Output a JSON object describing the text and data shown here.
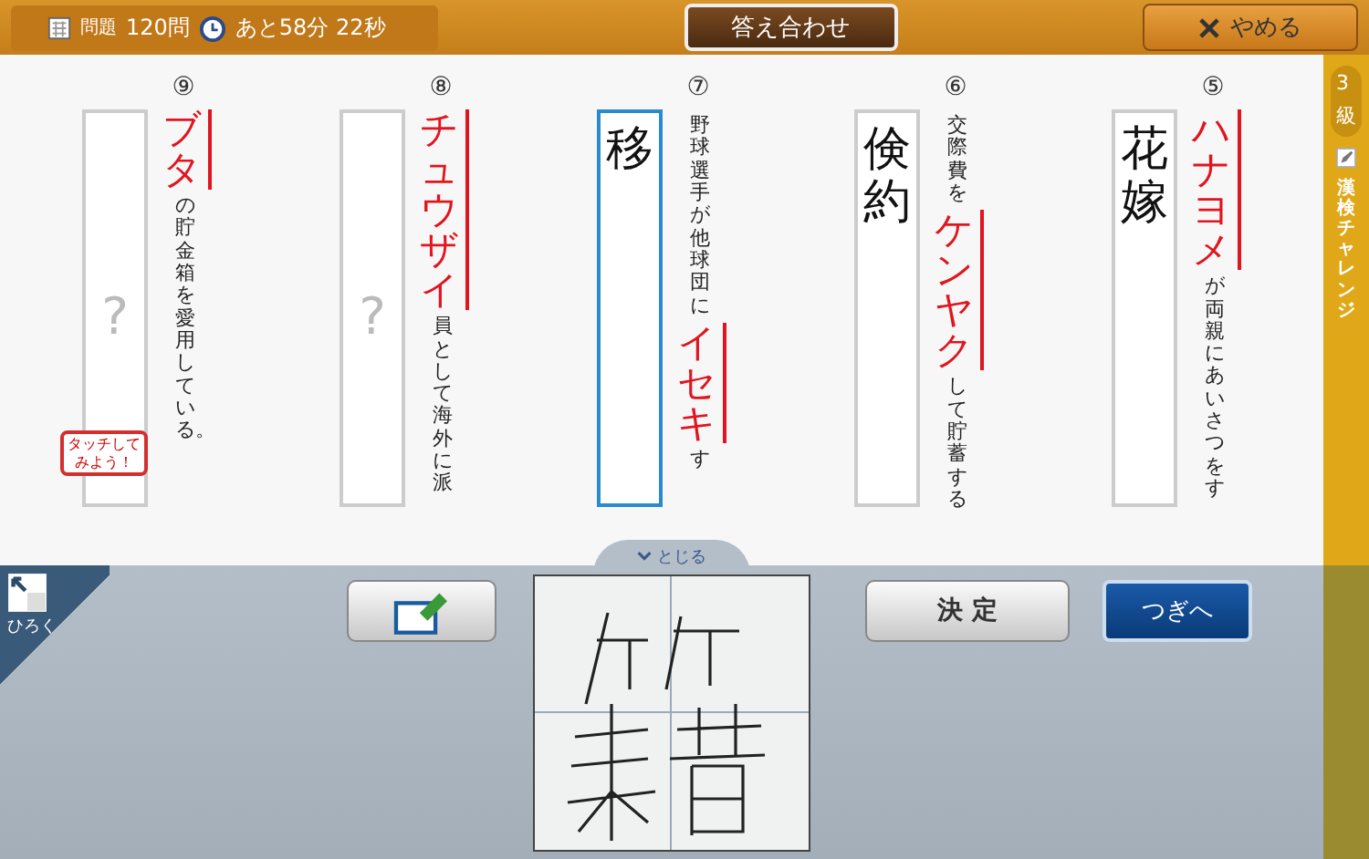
{
  "header": {
    "question_label": "問題",
    "question_count": "120問",
    "time_left": "あと58分 22秒",
    "check_button": "答え合わせ",
    "quit_button": "やめる"
  },
  "questions": [
    {
      "number": "⑨",
      "kana": "ブタ",
      "after": "の貯金箱を愛用している。",
      "answer": "?",
      "answered": false,
      "selected": false
    },
    {
      "number": "⑧",
      "kana": "チュウザイ",
      "after": "員として海外に派",
      "answer": "?",
      "answered": false,
      "selected": false
    },
    {
      "number": "⑦",
      "before": "野球選手が他球団に",
      "kana": "イセキ",
      "after": "す",
      "answer": "移",
      "answered": true,
      "selected": true
    },
    {
      "number": "⑥",
      "before": "交際費を",
      "kana": "ケンヤク",
      "after": "して貯蓄する",
      "answer": "倹約",
      "answered": true,
      "selected": false
    },
    {
      "number": "⑤",
      "kana": "ハナヨメ",
      "after": "が両親にあいさつをす",
      "answer": "花嫁",
      "answered": true,
      "selected": false
    }
  ],
  "hint_bubble": "タッチしてみよう！",
  "side_tab": {
    "level_number": "3",
    "level_unit": "級",
    "title": "漢検チャレンジ"
  },
  "close_tab": "とじる",
  "expand_button": "ひろく",
  "confirm_button": "決 定",
  "next_button": "つぎへ"
}
